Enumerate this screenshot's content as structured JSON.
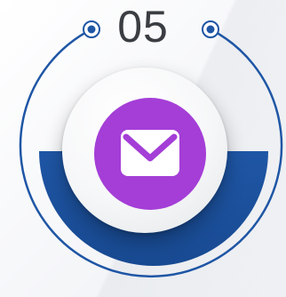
{
  "step": {
    "number": "05",
    "icon": "envelope-icon"
  },
  "colors": {
    "ring": "#1f56a5",
    "band": "#1f56a5",
    "icon_background": "#a43ed7",
    "icon_glyph": "#ffffff",
    "number_text": "#3a3d42"
  }
}
